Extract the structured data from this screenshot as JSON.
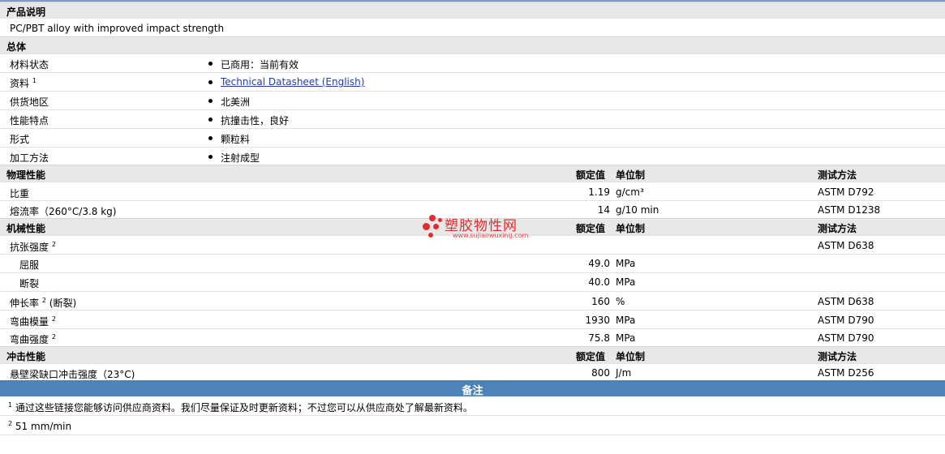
{
  "description": {
    "heading": "产品说明",
    "text": "PC/PBT alloy with improved impact strength"
  },
  "general": {
    "heading": "总体",
    "rows": [
      {
        "label": "材料状态",
        "value": "已商用：当前有效"
      },
      {
        "label": "资料",
        "sup": "1",
        "value": "Technical Datasheet (English)"
      },
      {
        "label": "供货地区",
        "value": "北美洲"
      },
      {
        "label": "性能特点",
        "value": "抗撞击性，良好"
      },
      {
        "label": "形式",
        "value": "颗粒料"
      },
      {
        "label": "加工方法",
        "value": "注射成型"
      }
    ]
  },
  "columns": {
    "value": "额定值",
    "unit": "单位制",
    "method": "测试方法"
  },
  "physical": {
    "heading": "物理性能",
    "rows": [
      {
        "label": "比重",
        "value": "1.19",
        "unit": "g/cm³",
        "method": "ASTM D792"
      },
      {
        "label": "熔流率（260°C/3.8 kg)",
        "value": "14",
        "unit": "g/10 min",
        "method": "ASTM D1238"
      }
    ]
  },
  "mechanical": {
    "heading": "机械性能",
    "tensile_label": "抗张强度",
    "tensile_sup": "2",
    "tensile_method": "ASTM D638",
    "yield_label": "屈服",
    "yield_value": "49.0",
    "yield_unit": "MPa",
    "break_label": "断裂",
    "break_value": "40.0",
    "break_unit": "MPa",
    "elong_label": "伸长率",
    "elong_sup": "2",
    "elong_suffix": "(断裂)",
    "elong_value": "160",
    "elong_unit": "%",
    "elong_method": "ASTM D638",
    "flexmod_label": "弯曲模量",
    "flexmod_sup": "2",
    "flexmod_value": "1930",
    "flexmod_unit": "MPa",
    "flexmod_method": "ASTM D790",
    "flexstr_label": "弯曲强度",
    "flexstr_sup": "2",
    "flexstr_value": "75.8",
    "flexstr_unit": "MPa",
    "flexstr_method": "ASTM D790"
  },
  "impact": {
    "heading": "冲击性能",
    "label": "悬壁梁缺口冲击强度（23°C)",
    "value": "800",
    "unit": "J/m",
    "method": "ASTM D256"
  },
  "notes": {
    "heading": "备注",
    "items": [
      {
        "sup": "1",
        "text": "通过这些链接您能够访问供应商资料。我们尽量保证及时更新资料；不过您可以从供应商处了解最新资料。"
      },
      {
        "sup": "2",
        "text": "51 mm/min"
      }
    ]
  },
  "watermark": {
    "title": "塑胶物性网",
    "url": "www.sujiaowuxing.com"
  },
  "colors": {
    "header_bg": "#e8e8e8",
    "notes_bar": "#4c83b8",
    "link": "#1f3fa8",
    "watermark": "#e52c2c"
  }
}
